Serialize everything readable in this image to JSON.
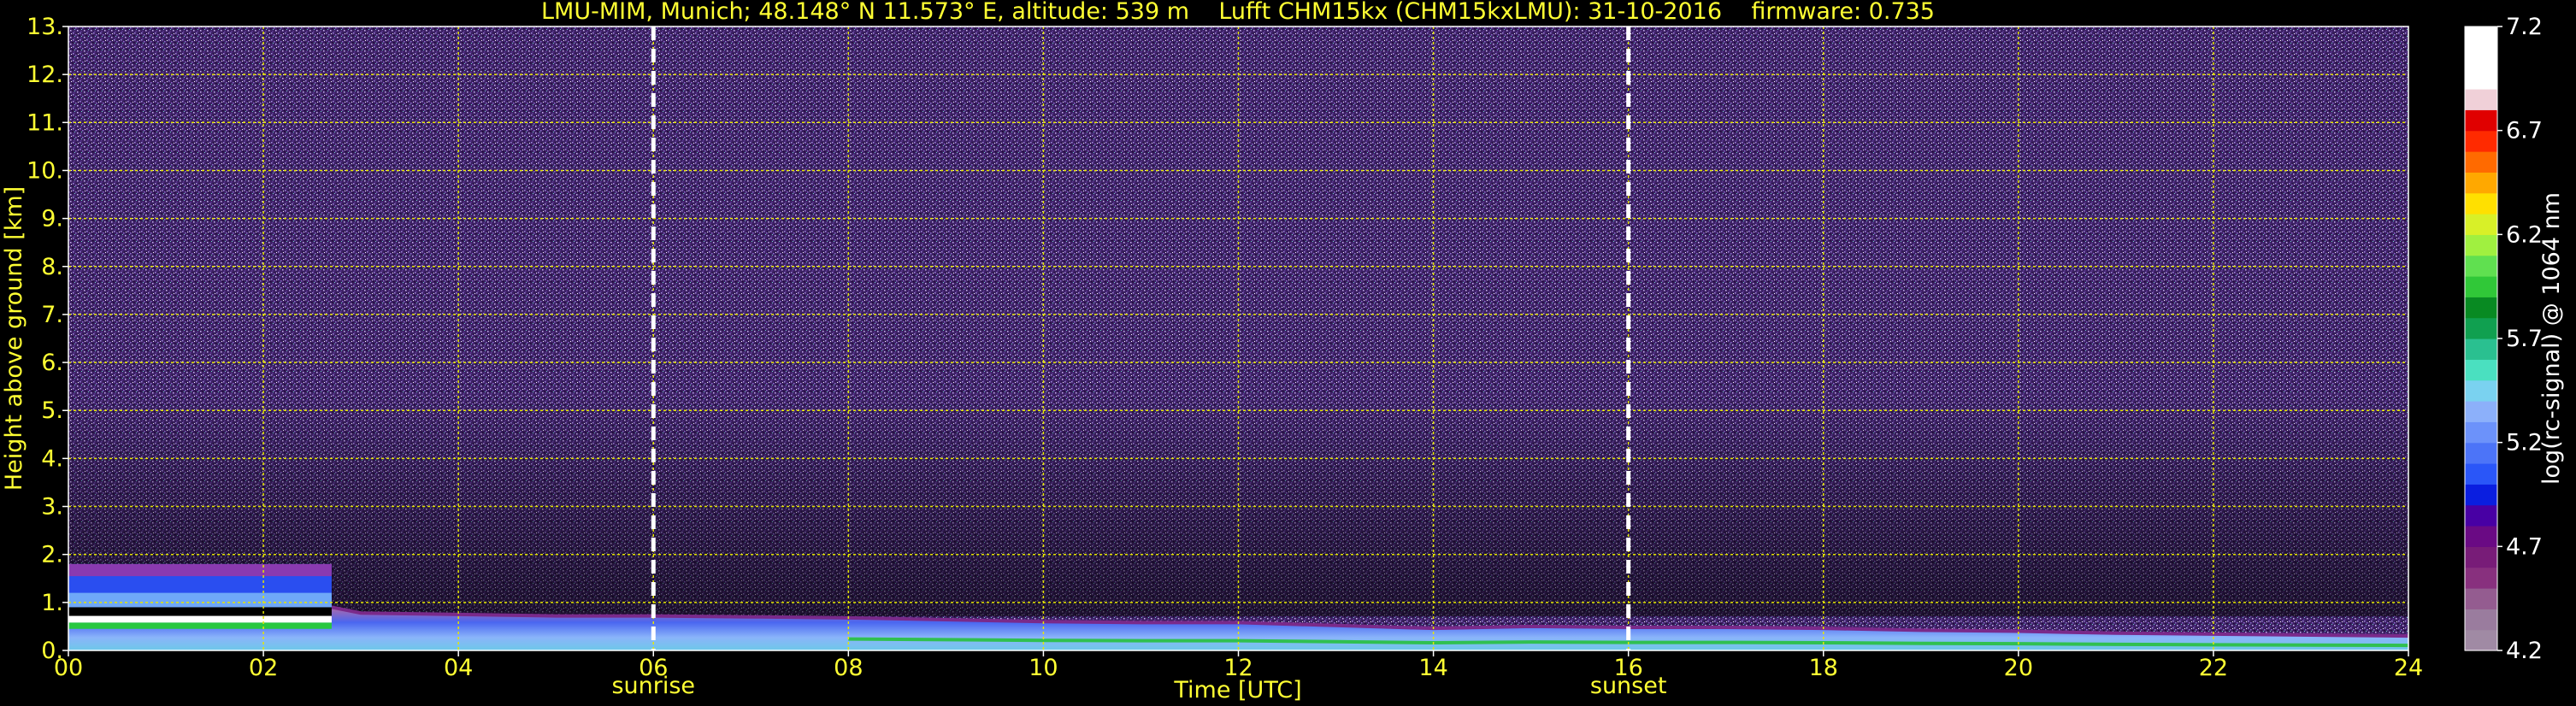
{
  "chart_data": {
    "type": "heatmap",
    "title": "LMU-MIM, Munich; 48.148° N 11.573° E, altitude: 539 m    Lufft CHM15kx (CHM15kxLMU): 31-10-2016    firmware: 0.735",
    "xlabel": "Time [UTC]",
    "ylabel": "Height above ground [km]",
    "xlim": [
      0,
      24
    ],
    "ylim": [
      0,
      13
    ],
    "x_ticks": [
      "00",
      "02",
      "04",
      "06",
      "08",
      "10",
      "12",
      "14",
      "16",
      "18",
      "20",
      "22",
      "24"
    ],
    "x_tick_values": [
      0,
      2,
      4,
      6,
      8,
      10,
      12,
      14,
      16,
      18,
      20,
      22,
      24
    ],
    "y_ticks": [
      "0.",
      "1.",
      "2.",
      "3.",
      "4.",
      "5.",
      "6.",
      "7.",
      "8.",
      "9.",
      "10.",
      "11.",
      "12.",
      "13."
    ],
    "y_tick_values": [
      0,
      1,
      2,
      3,
      4,
      5,
      6,
      7,
      8,
      9,
      10,
      11,
      12,
      13
    ],
    "grid": true,
    "annotations": [
      {
        "label": "sunrise",
        "x": 6.0
      },
      {
        "label": "sunset",
        "x": 16.0
      }
    ],
    "colorbar": {
      "label": "log(rc-signal) @ 1064 nm",
      "range": [
        4.2,
        7.2
      ],
      "tick_labels": [
        "4.2",
        "4.7",
        "5.2",
        "5.7",
        "6.2",
        "6.7",
        "7.2"
      ],
      "tick_values": [
        4.2,
        4.7,
        5.2,
        5.7,
        6.2,
        6.7,
        7.2
      ],
      "colors": [
        "#a08aa4",
        "#9a7c9e",
        "#945c90",
        "#88307e",
        "#781c78",
        "#6a0a84",
        "#4800a4",
        "#0a1ee0",
        "#2a56f8",
        "#4c74f8",
        "#6c92fa",
        "#8cb0fa",
        "#7ad2f0",
        "#4ae0c0",
        "#2ac090",
        "#10a050",
        "#088a22",
        "#30c838",
        "#60e050",
        "#a0f040",
        "#d8f028",
        "#ffe000",
        "#ffa800",
        "#ff6a00",
        "#ff2a00",
        "#e00000",
        "#f0d0d8",
        "#ffffff",
        "#ffffff",
        "#ffffff"
      ]
    },
    "features": [
      {
        "name": "boundary layer top",
        "points": [
          [
            0.0,
            0.9
          ],
          [
            2.7,
            0.9
          ],
          [
            3.0,
            0.78
          ],
          [
            4.0,
            0.75
          ],
          [
            5.0,
            0.72
          ],
          [
            6.0,
            0.72
          ],
          [
            7.0,
            0.7
          ],
          [
            8.0,
            0.68
          ],
          [
            9.0,
            0.64
          ],
          [
            10.0,
            0.6
          ],
          [
            11.0,
            0.58
          ],
          [
            12.0,
            0.58
          ],
          [
            13.0,
            0.52
          ],
          [
            14.0,
            0.46
          ],
          [
            15.0,
            0.5
          ],
          [
            16.0,
            0.48
          ],
          [
            17.0,
            0.48
          ],
          [
            18.0,
            0.46
          ],
          [
            19.0,
            0.42
          ],
          [
            20.0,
            0.4
          ],
          [
            21.0,
            0.36
          ],
          [
            22.0,
            0.34
          ],
          [
            23.0,
            0.32
          ],
          [
            24.0,
            0.3
          ]
        ]
      },
      {
        "name": "elevated layer",
        "x_range": [
          0.0,
          2.7
        ],
        "y_range": [
          0.9,
          1.8
        ]
      }
    ]
  }
}
